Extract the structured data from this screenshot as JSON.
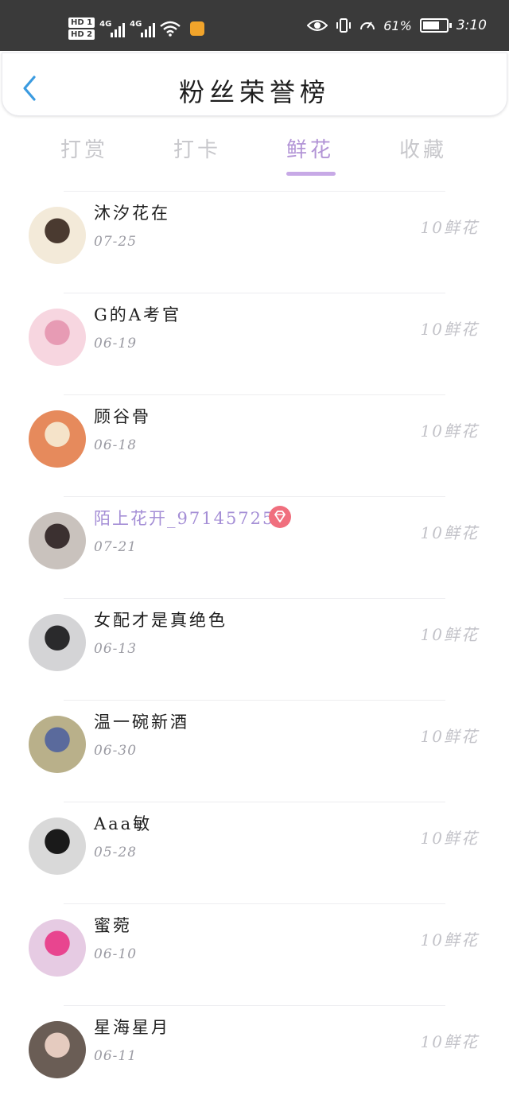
{
  "status_bar": {
    "hd1": "HD 1",
    "hd2": "HD 2",
    "net1": "4G",
    "net2": "4G",
    "battery_percent": "61%",
    "time": "3:10"
  },
  "header": {
    "title": "粉丝荣誉榜"
  },
  "tabs": [
    {
      "label": "打赏",
      "active": false
    },
    {
      "label": "打卡",
      "active": false
    },
    {
      "label": "鲜花",
      "active": true
    },
    {
      "label": "收藏",
      "active": false
    }
  ],
  "fans": [
    {
      "name": "沐汐花在",
      "date": "07-25",
      "gift": "10鲜花",
      "vip": false,
      "avatar_colors": [
        "#f3ead9",
        "#4a3a30"
      ]
    },
    {
      "name": "G的A考官",
      "date": "06-19",
      "gift": "10鲜花",
      "vip": false,
      "avatar_colors": [
        "#f7d6e0",
        "#e79bb4"
      ]
    },
    {
      "name": "顾谷骨",
      "date": "06-18",
      "gift": "10鲜花",
      "vip": false,
      "avatar_colors": [
        "#e68a5c",
        "#f5e3c9"
      ]
    },
    {
      "name": "陌上花开_971457258",
      "date": "07-21",
      "gift": "10鲜花",
      "vip": true,
      "avatar_colors": [
        "#c9c2bd",
        "#3b3030"
      ]
    },
    {
      "name": "女配才是真绝色",
      "date": "06-13",
      "gift": "10鲜花",
      "vip": false,
      "avatar_colors": [
        "#d4d4d6",
        "#2a2a2c"
      ]
    },
    {
      "name": "温一碗新酒",
      "date": "06-30",
      "gift": "10鲜花",
      "vip": false,
      "avatar_colors": [
        "#b9b08a",
        "#5a6a9c"
      ]
    },
    {
      "name": "Aaa敏",
      "date": "05-28",
      "gift": "10鲜花",
      "vip": false,
      "avatar_colors": [
        "#d9d9d9",
        "#1a1a1a"
      ]
    },
    {
      "name": "蜜菀",
      "date": "06-10",
      "gift": "10鲜花",
      "vip": false,
      "avatar_colors": [
        "#e6cbe3",
        "#e8458f"
      ]
    },
    {
      "name": "星海星月",
      "date": "06-11",
      "gift": "10鲜花",
      "vip": false,
      "avatar_colors": [
        "#6a5d55",
        "#e5cbbf"
      ]
    }
  ],
  "icons": {
    "back": "chevron-left-icon",
    "vip": "diamond-icon",
    "accent": "#b294d6"
  }
}
